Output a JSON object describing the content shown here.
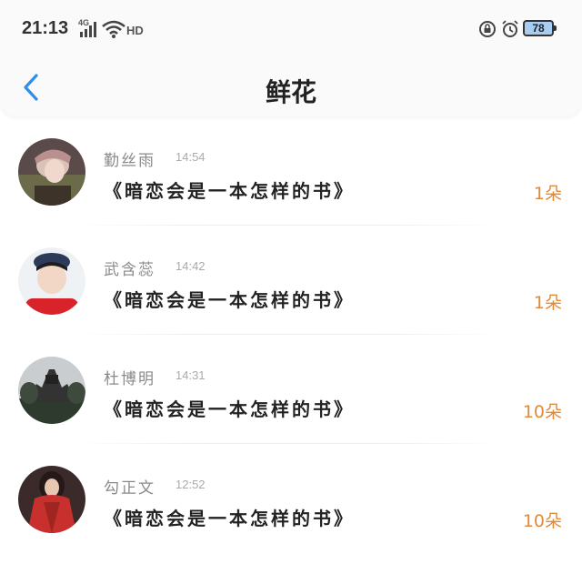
{
  "status_bar": {
    "time": "21:13",
    "network": "4G",
    "hd": "HD",
    "battery": "78",
    "icons": [
      "signal-icon",
      "wifi-icon",
      "lock-rotation-icon",
      "alarm-icon",
      "battery-icon"
    ]
  },
  "nav": {
    "back_icon": "chevron-left-icon",
    "title": "鲜花"
  },
  "colors": {
    "accent_blue": "#2f8ee8",
    "count_orange": "#e08a3c",
    "name_gray": "#8a8a8a"
  },
  "items": [
    {
      "name": "勤丝雨",
      "time": "14:54",
      "book": "《暗恋会是一本怎样的书》",
      "count": "1朵"
    },
    {
      "name": "武含蕊",
      "time": "14:42",
      "book": "《暗恋会是一本怎样的书》",
      "count": "1朵"
    },
    {
      "name": "杜博明",
      "time": "14:31",
      "book": "《暗恋会是一本怎样的书》",
      "count": "10朵"
    },
    {
      "name": "勾正文",
      "time": "12:52",
      "book": "《暗恋会是一本怎样的书》",
      "count": "10朵"
    }
  ]
}
